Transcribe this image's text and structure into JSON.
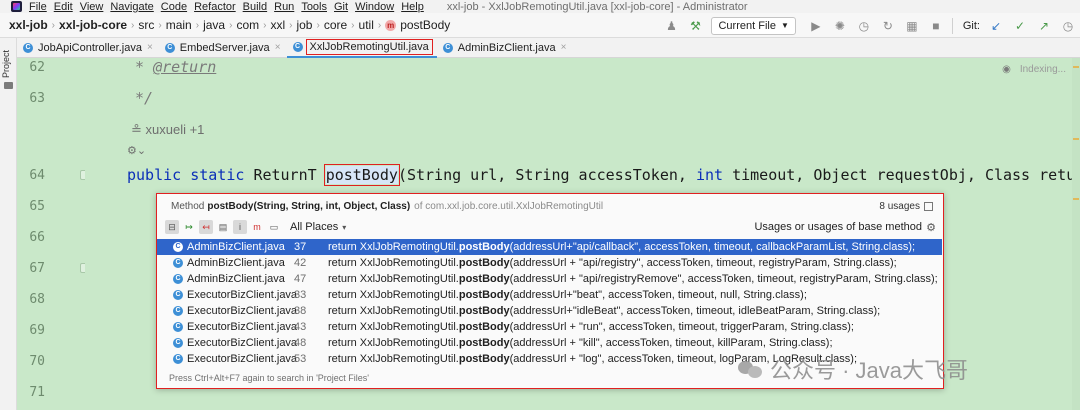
{
  "menubar": {
    "items": [
      "File",
      "Edit",
      "View",
      "Navigate",
      "Code",
      "Refactor",
      "Build",
      "Run",
      "Tools",
      "Git",
      "Window",
      "Help"
    ],
    "window_title": "xxl-job - XxlJobRemotingUtil.java [xxl-job-core] - Administrator"
  },
  "breadcrumbs": [
    "xxl-job",
    "xxl-job-core",
    "src",
    "main",
    "java",
    "com",
    "xxl",
    "job",
    "core",
    "util",
    "postBody"
  ],
  "toolbar": {
    "run_config": "Current File",
    "git_label": "Git:"
  },
  "sidebar": {
    "project_label": "Project"
  },
  "tabs": [
    {
      "label": "JobApiController.java",
      "active": false
    },
    {
      "label": "EmbedServer.java",
      "active": false
    },
    {
      "label": "XxlJobRemotingUtil.java",
      "active": true
    },
    {
      "label": "AdminBizClient.java",
      "active": false
    }
  ],
  "editor": {
    "line_numbers": [
      "62",
      "63",
      "64",
      "65",
      "66",
      "67",
      "68",
      "69",
      "70",
      "71"
    ],
    "line62": {
      "prefix": "* ",
      "tag": "@return"
    },
    "line63": "*/",
    "author_hint": "xuxueli +1",
    "line64": {
      "kw1": "public",
      "kw2": "static",
      "type": "ReturnT",
      "method": "postBody",
      "p1": "(String url, String accessToken, ",
      "kw3": "int",
      "p2": " timeout, Object requestObj, Class returnTar"
    },
    "indexing": "Indexing..."
  },
  "popup": {
    "method_prefix": "Method",
    "method_signature": "postBody(String, String, int, Object, Class)",
    "method_of": "of com.xxl.job.core.util.XxlJobRemotingUtil",
    "count": "8 usages",
    "scope": "All Places",
    "usage_kind": "Usages or usages of base method",
    "rows": [
      {
        "file": "AdminBizClient.java",
        "line": "37",
        "pre": "return XxlJobRemotingUtil.",
        "call": "postBody",
        "args": "(addressUrl+\"api/callback\", accessToken, timeout, callbackParamList, String.class);"
      },
      {
        "file": "AdminBizClient.java",
        "line": "42",
        "pre": "return XxlJobRemotingUtil.",
        "call": "postBody",
        "args": "(addressUrl + \"api/registry\", accessToken, timeout, registryParam, String.class);"
      },
      {
        "file": "AdminBizClient.java",
        "line": "47",
        "pre": "return XxlJobRemotingUtil.",
        "call": "postBody",
        "args": "(addressUrl + \"api/registryRemove\", accessToken, timeout, registryParam, String.class);"
      },
      {
        "file": "ExecutorBizClient.java",
        "line": "33",
        "pre": "return XxlJobRemotingUtil.",
        "call": "postBody",
        "args": "(addressUrl+\"beat\", accessToken, timeout, null, String.class);"
      },
      {
        "file": "ExecutorBizClient.java",
        "line": "38",
        "pre": "return XxlJobRemotingUtil.",
        "call": "postBody",
        "args": "(addressUrl+\"idleBeat\", accessToken, timeout, idleBeatParam, String.class);"
      },
      {
        "file": "ExecutorBizClient.java",
        "line": "43",
        "pre": "return XxlJobRemotingUtil.",
        "call": "postBody",
        "args": "(addressUrl + \"run\", accessToken, timeout, triggerParam, String.class);"
      },
      {
        "file": "ExecutorBizClient.java",
        "line": "48",
        "pre": "return XxlJobRemotingUtil.",
        "call": "postBody",
        "args": "(addressUrl + \"kill\", accessToken, timeout, killParam, String.class);"
      },
      {
        "file": "ExecutorBizClient.java",
        "line": "53",
        "pre": "return XxlJobRemotingUtil.",
        "call": "postBody",
        "args": "(addressUrl + \"log\", accessToken, timeout, logParam, LogResult.class);"
      }
    ],
    "footer": "Press Ctrl+Alt+F7 again to search in 'Project Files'"
  },
  "watermark": "公众号 · Java大飞哥",
  "colors": {
    "editor_bg": "#c9e8c9",
    "selection": "#2f65ca",
    "highlight_box": "#e02020",
    "keyword": "#0b2fb8"
  }
}
